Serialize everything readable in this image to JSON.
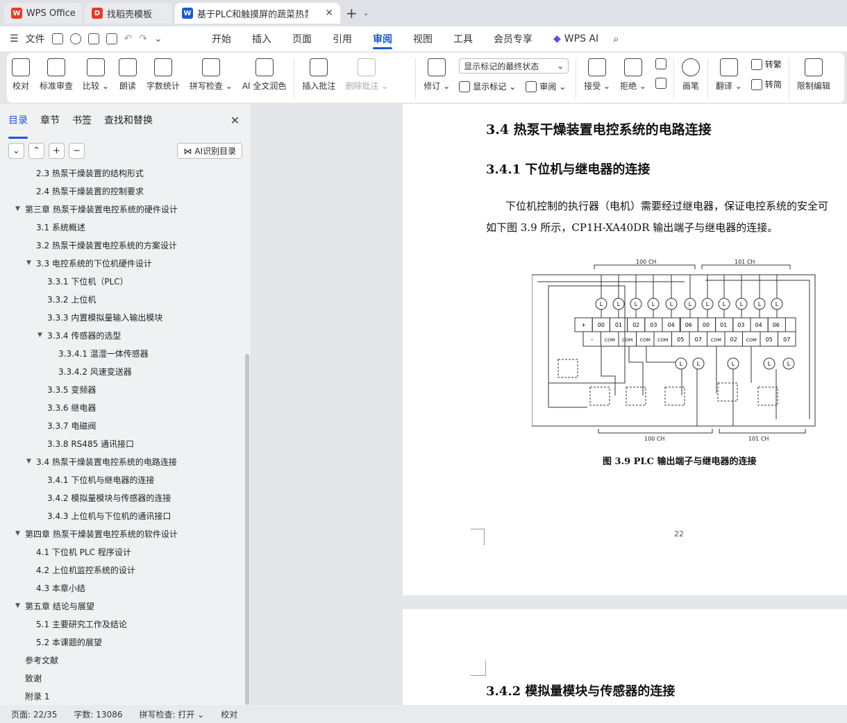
{
  "tabs": [
    {
      "label": "WPS Office",
      "logo": "W",
      "logo_color": "#e8392c"
    },
    {
      "label": "找稻壳模板",
      "logo": "D",
      "logo_color": "#e8392c"
    },
    {
      "label": "基于PLC和触摸屏的蔬菜热泵",
      "logo": "W",
      "logo_color": "#1c57d8"
    }
  ],
  "menubar": {
    "file": "文件",
    "items": [
      "开始",
      "插入",
      "页面",
      "引用",
      "审阅",
      "视图",
      "工具",
      "会员专享"
    ],
    "active": "审阅",
    "wps_ai": "WPS AI"
  },
  "ribbon": {
    "proofread": "校对",
    "std_review": "标准审查",
    "compare": "比较",
    "read_aloud": "朗读",
    "word_count": "字数统计",
    "spell_check": "拼写检查",
    "ai_polish": "AI 全文润色",
    "insert_comment": "插入批注",
    "delete_comment": "删除批注",
    "markup_select": "显示标记的最终状态",
    "track_changes": "修订",
    "show_markup": "显示标记",
    "review": "审阅",
    "accept": "接受",
    "reject": "拒绝",
    "pen": "画笔",
    "translate": "翻译",
    "to_traditional": "转繁",
    "to_simplified": "转简",
    "restrict_edit": "限制编辑"
  },
  "left_panel": {
    "tabs": [
      "目录",
      "章节",
      "书签",
      "查找和替换"
    ],
    "active_tab": "目录",
    "ai_toc": "AI识别目录",
    "toc": [
      {
        "label": "2.3 热泵干燥装置的结构形式",
        "level": 2,
        "arrow": ""
      },
      {
        "label": "2.4 热泵干燥装置的控制要求",
        "level": 2,
        "arrow": ""
      },
      {
        "label": "第三章  热泵干燥装置电控系统的硬件设计",
        "level": 1,
        "arrow": "▼"
      },
      {
        "label": "3.1 系统概述",
        "level": 2,
        "arrow": ""
      },
      {
        "label": "3.2 热泵干燥装置电控系统的方案设计",
        "level": 2,
        "arrow": ""
      },
      {
        "label": "3.3 电控系统的下位机硬件设计",
        "level": 2,
        "arrow": "▼"
      },
      {
        "label": "3.3.1 下位机（PLC）",
        "level": 3,
        "arrow": ""
      },
      {
        "label": "3.3.2 上位机",
        "level": 3,
        "arrow": ""
      },
      {
        "label": "3.3.3 内置模拟量输入输出模块",
        "level": 3,
        "arrow": ""
      },
      {
        "label": "3.3.4 传感器的选型",
        "level": 3,
        "arrow": "▼"
      },
      {
        "label": "3.3.4.1 温湿一体传感器",
        "level": 4,
        "arrow": ""
      },
      {
        "label": "3.3.4.2  风速变送器",
        "level": 4,
        "arrow": ""
      },
      {
        "label": "3.3.5 变频器",
        "level": 3,
        "arrow": ""
      },
      {
        "label": "3.3.6 继电器",
        "level": 3,
        "arrow": ""
      },
      {
        "label": "3.3.7 电磁阀",
        "level": 3,
        "arrow": ""
      },
      {
        "label": "3.3.8 RS485 通讯接口",
        "level": 3,
        "arrow": ""
      },
      {
        "label": "3.4 热泵干燥装置电控系统的电路连接",
        "level": 2,
        "arrow": "▼"
      },
      {
        "label": "3.4.1 下位机与继电器的连接",
        "level": 3,
        "arrow": ""
      },
      {
        "label": "3.4.2 模拟量模块与传感器的连接",
        "level": 3,
        "arrow": ""
      },
      {
        "label": "3.4.3 上位机与下位机的通讯接口",
        "level": 3,
        "arrow": ""
      },
      {
        "label": "第四章  热泵干燥装置电控系统的软件设计",
        "level": 1,
        "arrow": "▼"
      },
      {
        "label": "4.1 下位机 PLC 程序设计",
        "level": 2,
        "arrow": ""
      },
      {
        "label": "4.2 上位机监控系统的设计",
        "level": 2,
        "arrow": ""
      },
      {
        "label": "4.3 本章小结",
        "level": 2,
        "arrow": ""
      },
      {
        "label": "第五章  结论与展望",
        "level": 1,
        "arrow": "▼"
      },
      {
        "label": "5.1 主要研究工作及结论",
        "level": 2,
        "arrow": ""
      },
      {
        "label": "5.2 本课题的展望",
        "level": 2,
        "arrow": ""
      },
      {
        "label": "参考文献",
        "level": 1,
        "arrow": ""
      },
      {
        "label": "致谢",
        "level": 1,
        "arrow": ""
      },
      {
        "label": "附录 1",
        "level": 1,
        "arrow": ""
      }
    ]
  },
  "document": {
    "h_3_4": "3.4 热泵干燥装置电控系统的电路连接",
    "h_3_4_1": "3.4.1 下位机与继电器的连接",
    "para_line1": "下位机控制的执行器（电机）需要经过继电器，保证电控系统的安全可",
    "para_line2": "如下图 3.9 所示，CP1H-XA40DR 输出端子与继电器的连接。",
    "figure": {
      "top_group_left": "100 CH",
      "top_group_right": "101 CH",
      "bottom_group_left": "100 CH",
      "bottom_group_right": "101 CH",
      "row1": [
        "+",
        "00",
        "01",
        "02",
        "03",
        "04",
        "06",
        "00",
        "01",
        "03",
        "04",
        "06"
      ],
      "row2": [
        "–",
        "COM",
        "COM",
        "COM",
        "COM",
        "05",
        "07",
        "COM",
        "02",
        "COM",
        "05",
        "07"
      ],
      "lamp_label": "L"
    },
    "caption": "图 3.9 PLC 输出端子与继电器的连接",
    "page_number": "22",
    "h_3_4_2": "3.4.2 模拟量模块与传感器的连接"
  },
  "statusbar": {
    "page": "页面: 22/35",
    "words": "字数: 13086",
    "spell": "拼写检查: 打开",
    "proof": "校对"
  }
}
